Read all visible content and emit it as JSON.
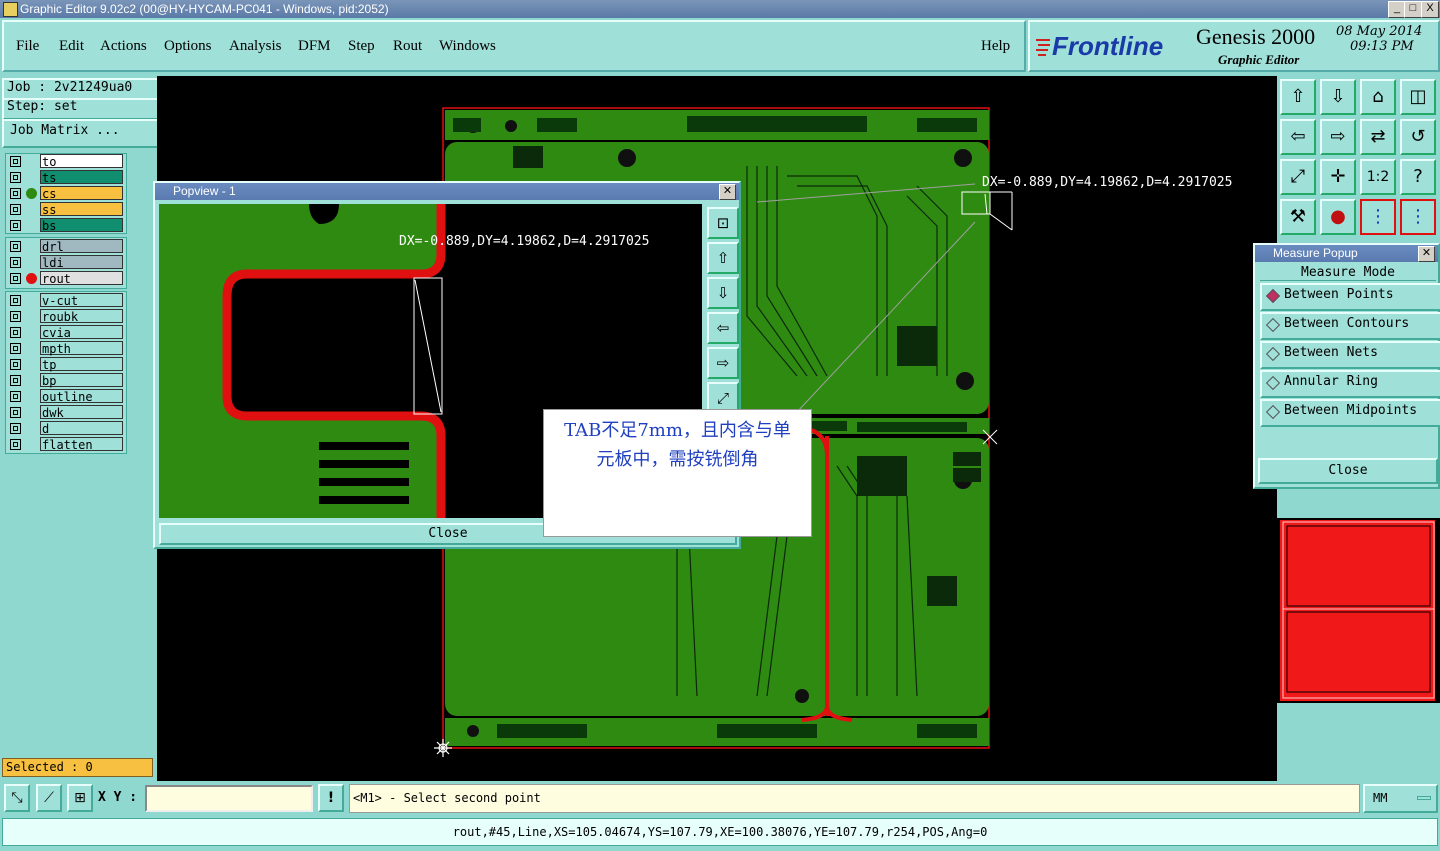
{
  "window": {
    "title": "Graphic Editor 9.02c2 (00@HY-HYCAM-PC041 - Windows, pid:2052)",
    "controls": [
      "_",
      "□",
      "X"
    ]
  },
  "menu": [
    "File",
    "Edit",
    "Actions",
    "Options",
    "Analysis",
    "DFM",
    "Step",
    "Rout",
    "Windows"
  ],
  "help_label": "Help",
  "branding": {
    "logo": "Frontline",
    "product": "Genesis 2000",
    "subtitle": "Graphic Editor",
    "date": "08 May 2014",
    "time": "09:13 PM"
  },
  "job": {
    "job_line": "Job : 2v21249ua0",
    "step_line": "Step: set",
    "matrix_button": "Job Matrix ..."
  },
  "layers": {
    "group1": [
      {
        "name": "to",
        "color": "#ffffff"
      },
      {
        "name": "ts",
        "color": "#0f8f6f"
      },
      {
        "name": "cs",
        "color": "#f8c040"
      },
      {
        "name": "ss",
        "color": "#f8c040"
      },
      {
        "name": "bs",
        "color": "#0f8f6f"
      }
    ],
    "group2": [
      {
        "name": "drl",
        "color": "#a0b8c0"
      },
      {
        "name": "ldi",
        "color": "#a0b8c0"
      },
      {
        "name": "rout",
        "color": "#e0e0e0"
      }
    ],
    "group3": [
      {
        "name": "v-cut",
        "color": "#9fe0d8"
      },
      {
        "name": "roubk",
        "color": "#9fe0d8"
      },
      {
        "name": "cvia",
        "color": "#9fe0d8"
      },
      {
        "name": "mpth",
        "color": "#9fe0d8"
      },
      {
        "name": "tp",
        "color": "#9fe0d8"
      },
      {
        "name": "bp",
        "color": "#9fe0d8"
      },
      {
        "name": "outline",
        "color": "#9fe0d8"
      },
      {
        "name": "dwk",
        "color": "#9fe0d8"
      },
      {
        "name": "d",
        "color": "#9fe0d8"
      },
      {
        "name": "flatten",
        "color": "#9fe0d8"
      }
    ]
  },
  "selected_label": "Selected : 0",
  "popview": {
    "title": "Popview - 1",
    "measure_text": "DX=-0.889,DY=4.19862,D=4.2917025",
    "close_label": "Close"
  },
  "canvas_measure_text": "DX=-0.889,DY=4.19862,D=4.2917025",
  "annotation": {
    "line1": "TAB不足7mm，且内含与单",
    "line2": "元板中，需按铣倒角"
  },
  "measure_popup": {
    "title": "Measure Popup",
    "mode_label": "Measure Mode",
    "options": [
      "Between Points",
      "Between Contours",
      "Between Nets",
      "Annular Ring",
      "Between Midpoints"
    ],
    "selected_option": "Between Points",
    "close_label": "Close"
  },
  "bottom": {
    "xy_label": "X Y :",
    "xy_value": "",
    "prompt": "<M1> - Select second point",
    "units": "MM",
    "status": "rout,#45,Line,XS=105.04674,YS=107.79,XE=100.38076,YE=107.79,r254,POS,Ang=0"
  },
  "colors": {
    "panel": "#8fd8d0",
    "board_green": "#2f8a12",
    "rout_red": "#e01010",
    "minimap_red": "#f01818"
  }
}
